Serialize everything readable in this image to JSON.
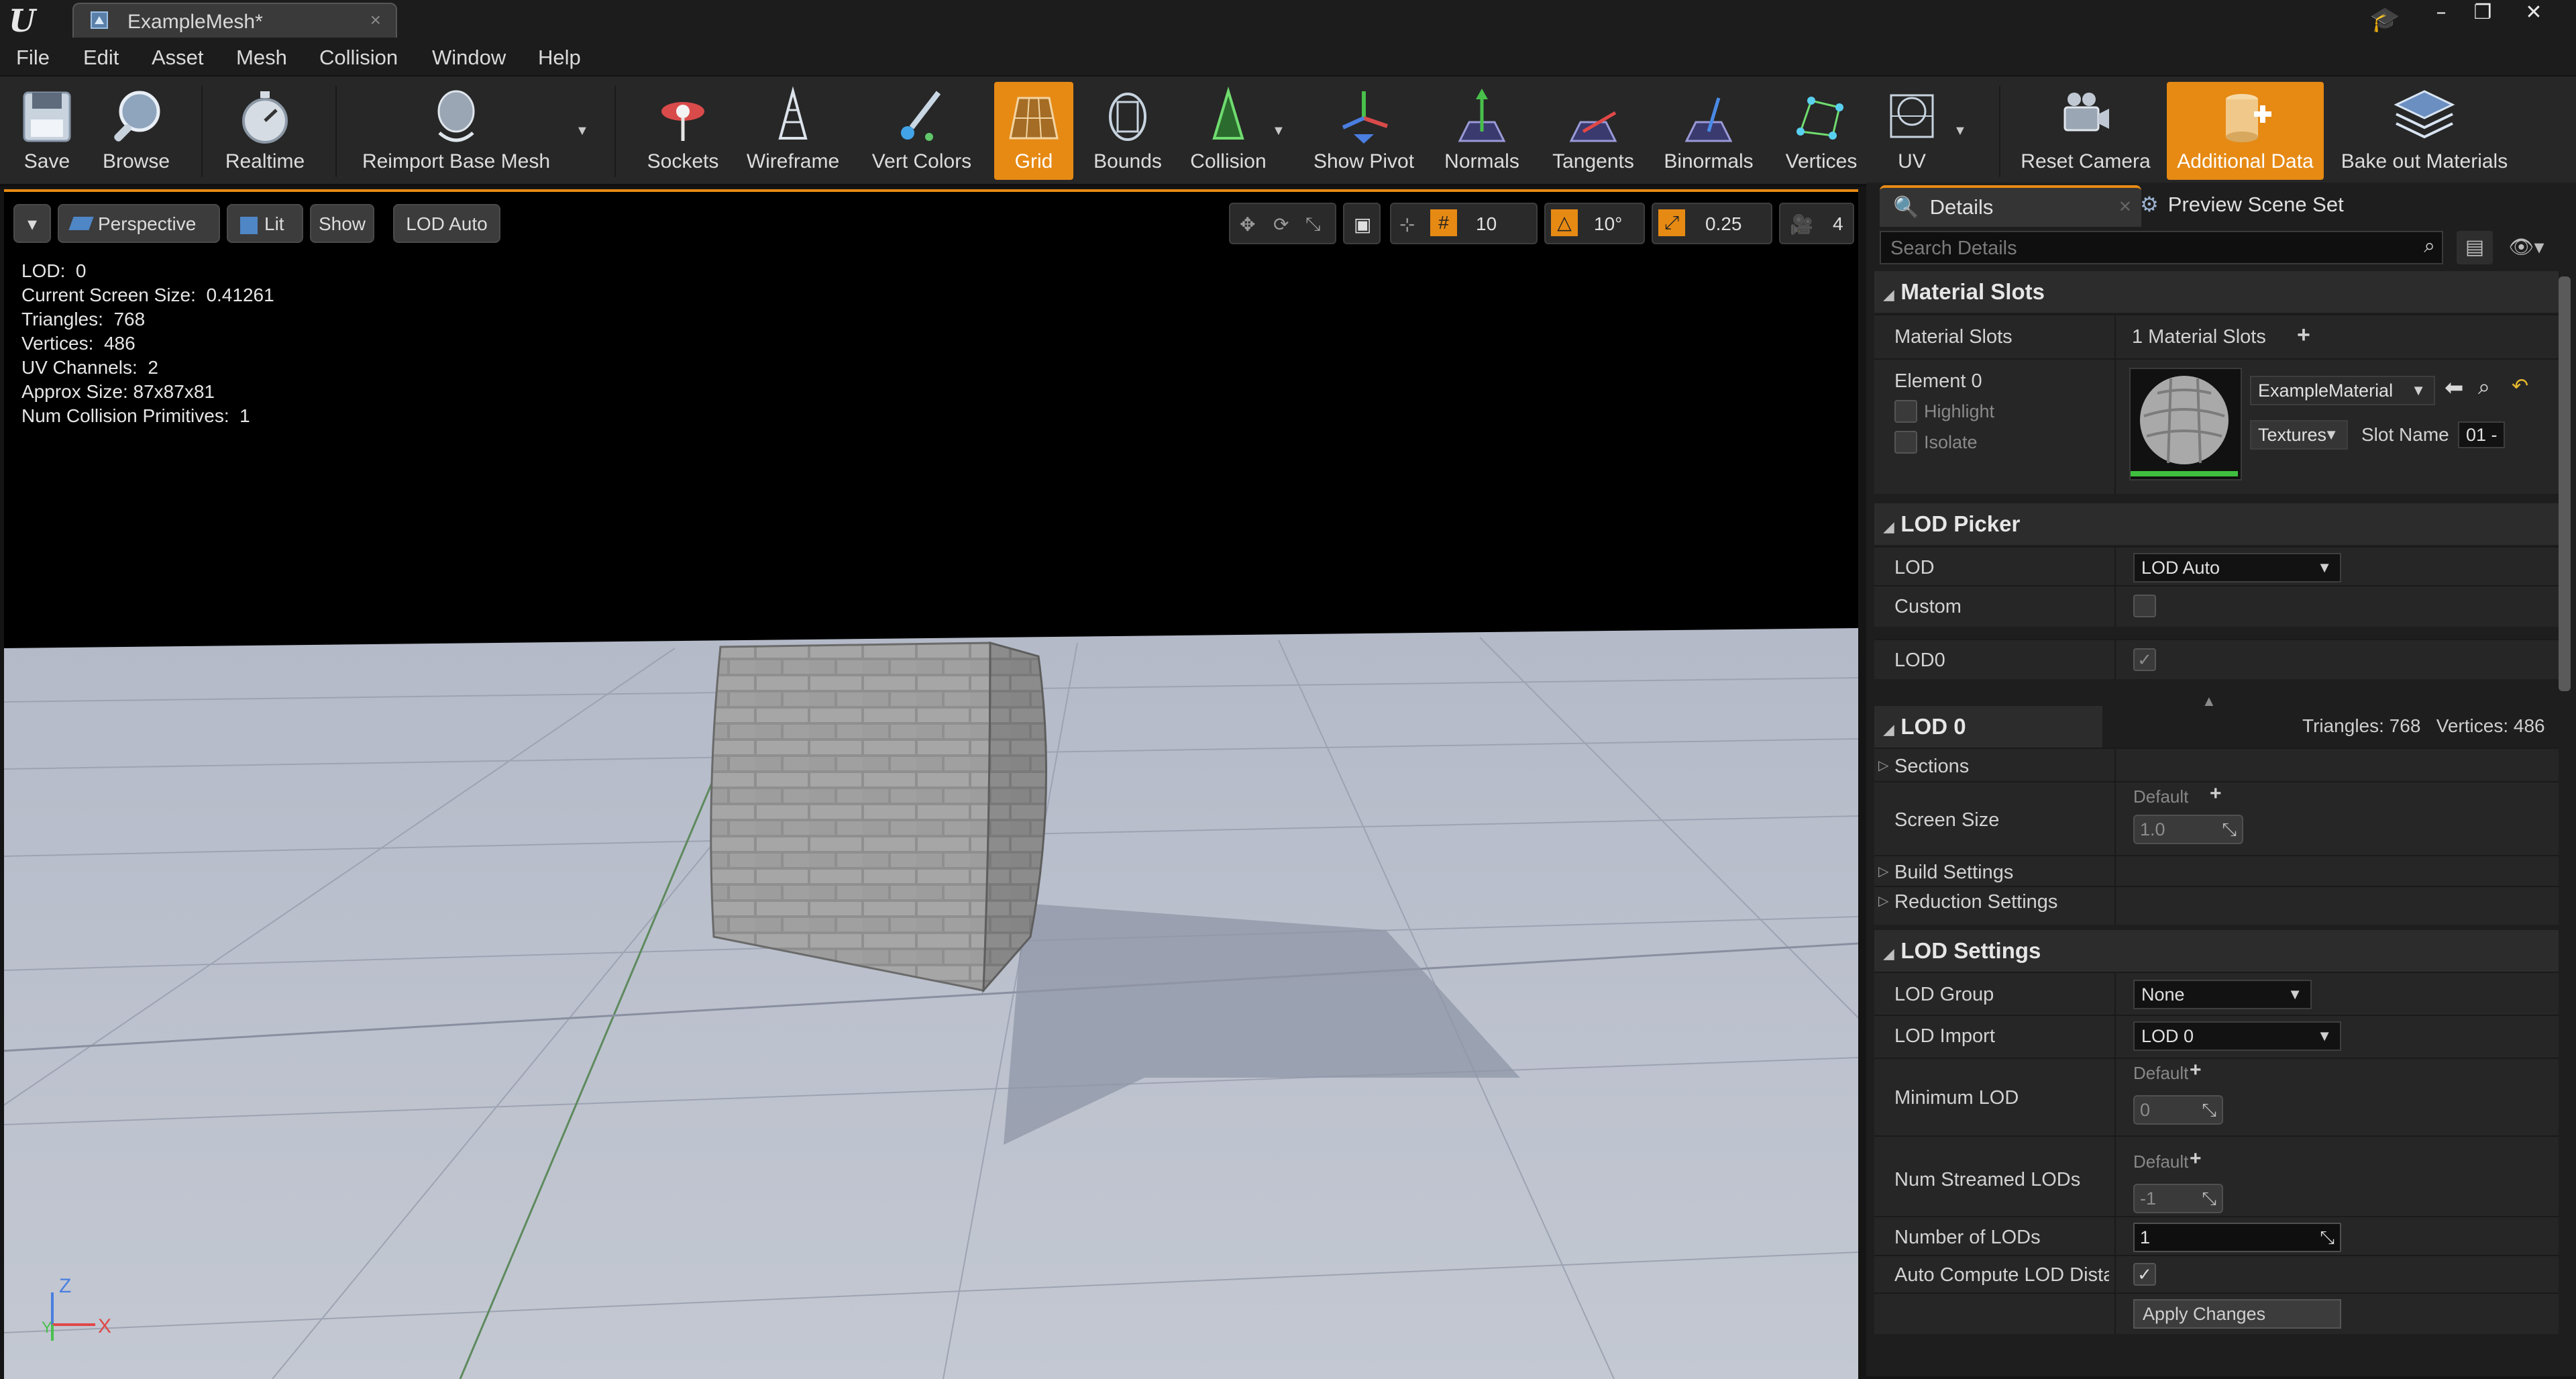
{
  "window": {
    "tab_title": "ExampleMesh*",
    "tab_close": "×",
    "minimize": "–",
    "restore": "❐",
    "close": "✕"
  },
  "menu": [
    "File",
    "Edit",
    "Asset",
    "Mesh",
    "Collision",
    "Window",
    "Help"
  ],
  "toolbar": {
    "save": "Save",
    "browse": "Browse",
    "realtime": "Realtime",
    "reimport": "Reimport Base Mesh",
    "sockets": "Sockets",
    "wireframe": "Wireframe",
    "vert_colors": "Vert Colors",
    "grid": "Grid",
    "bounds": "Bounds",
    "collision": "Collision",
    "show_pivot": "Show Pivot",
    "normals": "Normals",
    "tangents": "Tangents",
    "binormals": "Binormals",
    "vertices": "Vertices",
    "uv": "UV",
    "reset_camera": "Reset Camera",
    "additional_data": "Additional Data",
    "bake_out": "Bake out Materials",
    "accent": "#e68a14"
  },
  "viewport": {
    "perspective": "Perspective",
    "lit": "Lit",
    "show": "Show",
    "lod_auto": "LOD Auto",
    "grid_snap": "10",
    "rot_snap": "10°",
    "scale_snap": "0.25",
    "cam_speed": "4",
    "stats": [
      "LOD:  0",
      "Current Screen Size:  0.41261",
      "Triangles:  768",
      "Vertices:  486",
      "UV Channels:  2",
      "Approx Size: 87x87x81",
      "Num Collision Primitives:  1"
    ],
    "axis_z": "Z",
    "axis_x": "X",
    "axis_y": "Y"
  },
  "details": {
    "tab_details": "Details",
    "tab_scene": "Preview Scene Set",
    "search_placeholder": "Search Details",
    "material_slots_cat": "Material Slots",
    "material_slots_label": "Material Slots",
    "material_slots_value": "1 Material Slots",
    "element0": "Element 0",
    "highlight": "Highlight",
    "isolate": "Isolate",
    "material_name": "ExampleMaterial",
    "textures": "Textures",
    "slot_name_label": "Slot Name",
    "slot_name_value": "01 -",
    "lod_picker_cat": "LOD Picker",
    "lod_label": "LOD",
    "lod_value": "LOD Auto",
    "custom_label": "Custom",
    "lod0_label": "LOD0",
    "lod0_stats": "Triangles: 768   Vertices: 486",
    "lod0_cat": "LOD 0",
    "sections": "Sections",
    "screen_size": "Screen Size",
    "default": "Default",
    "screen_size_value": "1.0",
    "build_settings": "Build Settings",
    "reduction_settings": "Reduction Settings",
    "lod_settings_cat": "LOD Settings",
    "lod_group_label": "LOD Group",
    "lod_group_value": "None",
    "lod_import_label": "LOD Import",
    "lod_import_value": "LOD 0",
    "min_lod_label": "Minimum LOD",
    "min_lod_value": "0",
    "num_streamed_label": "Num Streamed LODs",
    "num_streamed_value": "-1",
    "num_lods_label": "Number of LODs",
    "num_lods_value": "1",
    "auto_compute_label": "Auto Compute LOD Distai",
    "apply_changes": "Apply Changes",
    "check": "✓"
  }
}
